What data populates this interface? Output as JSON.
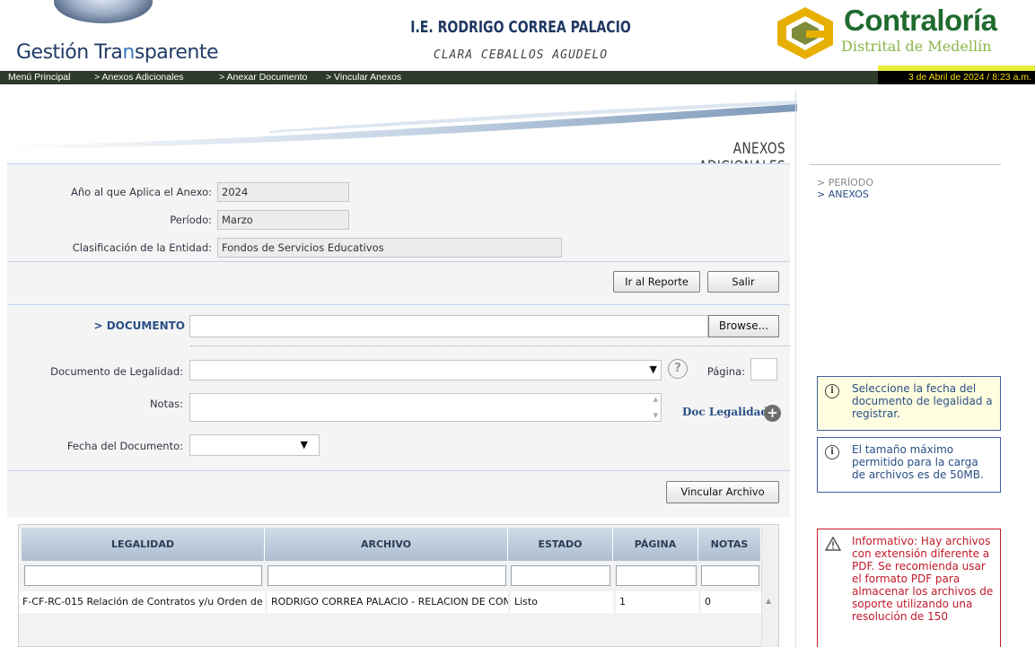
{
  "header": {
    "brand_left": "Gestión Tra",
    "brand_highlight": "n",
    "brand_right": "sparente",
    "institution": "I.E. RODRIGO CORREA PALACIO",
    "person": "CLARA CEBALLOS AGUDELO",
    "contraloria_title": "Contraloría",
    "contraloria_sub": "Distrital de Medellín"
  },
  "breadcrumb": {
    "items": [
      "Menú Principal",
      "> Anexos Adicionales",
      "> Anexar Documento",
      "> Vincular Anexos"
    ],
    "date": "3 de Abril de 2024 / 8:23 a.m."
  },
  "page": {
    "section_title": "ANEXOS ADICIONALES"
  },
  "form": {
    "anio_label": "Año al que Aplica el Anexo:",
    "anio_value": "2024",
    "periodo_label": "Período:",
    "periodo_value": "Marzo",
    "clasificacion_label": "Clasificación de la Entidad:",
    "clasificacion_value": "Fondos de Servicios Educativos",
    "ir_reporte": "Ir al Reporte",
    "salir": "Salir",
    "documento_label": "> DOCUMENTO",
    "browse": "Browse...",
    "doc_legalidad_label": "Documento de Legalidad:",
    "pagina_label": "Página:",
    "notas_label": "Notas:",
    "doc_legalidad_link": "Doc Legalidad",
    "fecha_label": "Fecha del Documento:",
    "vincular": "Vincular Archivo"
  },
  "side": {
    "nav": [
      "> PERÍODO",
      "> ANEXOS"
    ],
    "note1": "Seleccione la fecha del documento de legalidad a registrar.",
    "note2": "El tamaño máximo permitido para la carga de archivos es de 50MB.",
    "note3": "Informativo: Hay archivos con extensión diferente a PDF. Se recomienda usar el formato PDF para almacenar los archivos de soporte utilizando una resolución de 150"
  },
  "table": {
    "columns": [
      "LEGALIDAD",
      "ARCHIVO",
      "ESTADO",
      "PÁGINA",
      "NOTAS"
    ],
    "rows": [
      [
        "F-CF-RC-015 Relación de Contratos y/u Orden de",
        "RODRIGO CORREA PALACIO - RELACION DE CONTRATOS",
        "Listo",
        "1",
        "0"
      ]
    ]
  },
  "colors": {
    "navbar": "#2f3b2a",
    "date_text": "#f5d90a",
    "link_blue": "#2a4f86",
    "note_blue_border": "#3b5fa0",
    "note_yellow_bg": "#fffde0",
    "note_red_border": "#c0192a",
    "note_red_text": "#c0192a"
  }
}
